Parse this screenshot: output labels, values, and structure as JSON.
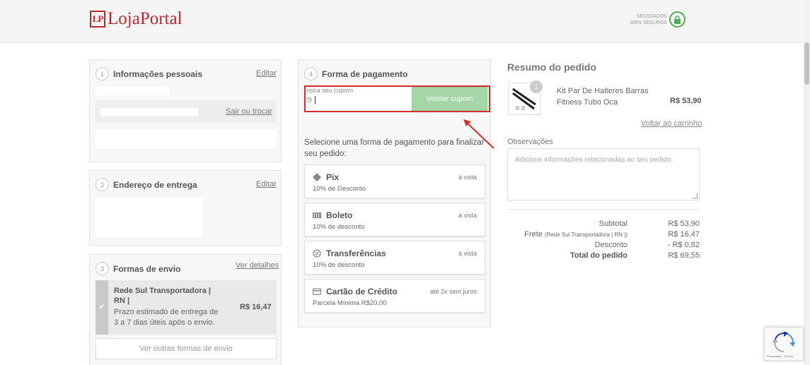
{
  "header": {
    "logo_mark": "LP",
    "logo_text": "LojaPortal",
    "secure_line1": "SEGSDADOS",
    "secure_line2": "100% SEGUROS"
  },
  "personal": {
    "step": "1",
    "title": "Informações pessoais",
    "edit": "Editar",
    "switch": "Sair ou trocar"
  },
  "address": {
    "step": "2",
    "title": "Endereço de entrega",
    "edit": "Editar"
  },
  "shipping": {
    "step": "3",
    "title": "Formas de envio",
    "details": "Ver detalhes",
    "option_name": "Rede Sul Transportadora | RN |",
    "option_desc": "Prazo estimado de entrega de 3 a 7 dias úteis após o envio.",
    "option_price": "R$ 16,47",
    "more": "Ver outras formas de envio"
  },
  "payment": {
    "step": "4",
    "title": "Forma de pagamento",
    "coupon_label": "nsira seu cupom",
    "coupon_button": "Validar cupom",
    "intro": "Selecione uma forma de pagamento para finalizar seu pedido:",
    "methods": [
      {
        "name": "Pix",
        "sub": "10% de Desconto",
        "right": "à vista",
        "icon": "pix-icon"
      },
      {
        "name": "Boleto",
        "sub": "10% de desconto",
        "right": "à vista",
        "icon": "barcode-icon"
      },
      {
        "name": "Transferências",
        "sub": "10% de desconto",
        "right": "à vista",
        "icon": "transfer-icon"
      },
      {
        "name": "Cartão de Crédito",
        "sub": "Parcela Mínima R$20,00",
        "right": "até 2x sem juros",
        "icon": "credit-card-icon"
      }
    ]
  },
  "summary": {
    "title": "Resumo do pedido",
    "product_qty": "1",
    "product_name": "Kit Par De Halteres Barras Fitness Tubo Oca",
    "product_price": "R$ 53,90",
    "back_to_cart": "Voltar ao carrinho",
    "obs_label": "Observações",
    "obs_placeholder": "Adicione informações relacionadas ao seu pedido",
    "subtotal_label": "Subtotal",
    "subtotal": "R$ 53,90",
    "frete_label": "Frete",
    "frete_detail": "(Rede Sul Transportadora | RN |)",
    "frete": "R$ 16,47",
    "desconto_label": "Desconto",
    "desconto": "- R$ 0,82",
    "total_label": "Total do pedido",
    "total": "R$ 69,55"
  },
  "recaptcha": {
    "text": "Privacidade - Termos"
  },
  "colors": {
    "brand": "#c0272d",
    "secure": "#4caf50",
    "coupon_button": "#a5d6a7",
    "highlight": "#d32f2f"
  }
}
